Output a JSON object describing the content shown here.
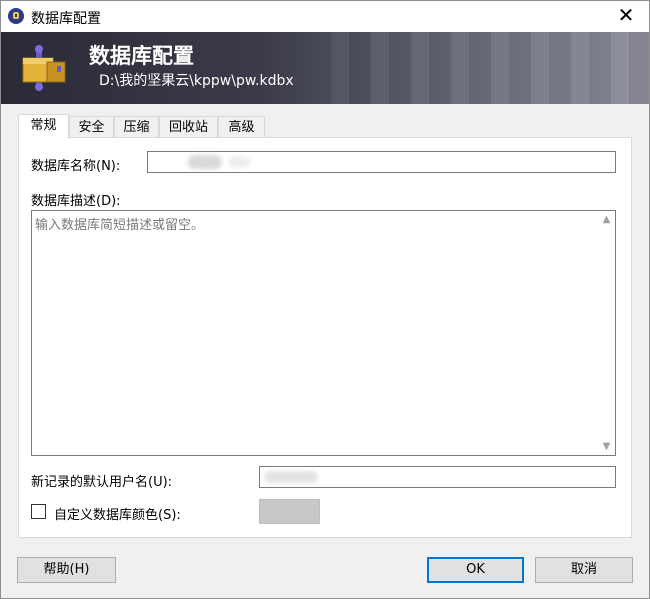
{
  "window": {
    "title": "数据库配置"
  },
  "banner": {
    "title": "数据库配置",
    "path": "D:\\我的坚果云\\kppw\\pw.kdbx"
  },
  "tabs": [
    {
      "label": "常规",
      "active": true
    },
    {
      "label": "安全",
      "active": false
    },
    {
      "label": "压缩",
      "active": false
    },
    {
      "label": "回收站",
      "active": false
    },
    {
      "label": "高级",
      "active": false
    }
  ],
  "form": {
    "name_label": "数据库名称(N):",
    "name_value": "",
    "desc_label": "数据库描述(D):",
    "desc_placeholder": "输入数据库简短描述或留空。",
    "username_label": "新记录的默认用户名(U):",
    "username_value": "",
    "color_label": "自定义数据库颜色(S):",
    "color_checked": false,
    "color_swatch": "#c8c8c8"
  },
  "buttons": {
    "help": "帮助(H)",
    "ok": "OK",
    "cancel": "取消"
  },
  "icons": {
    "app": "lock-icon",
    "banner": "database-icon",
    "close": "close-icon"
  }
}
